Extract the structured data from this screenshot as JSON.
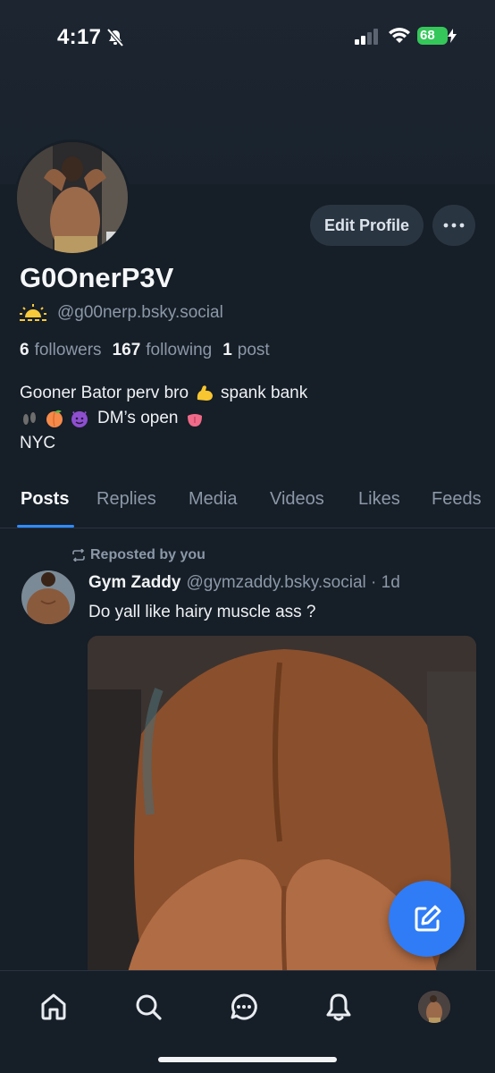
{
  "status_bar": {
    "time": "4:17",
    "battery": "68"
  },
  "profile": {
    "display_name": "G0OnerP3V",
    "handle": "@g00nerp.bsky.social",
    "edit_label": "Edit Profile",
    "followers_count": "6",
    "followers_label": "followers",
    "following_count": "167",
    "following_label": "following",
    "posts_count": "1",
    "posts_label": "post",
    "bio": {
      "line1_a": "Gooner Bator perv bro",
      "line1_b": "spank bank",
      "line2": "DM’s open",
      "line3": "NYC"
    }
  },
  "tabs": [
    "Posts",
    "Replies",
    "Media",
    "Videos",
    "Likes",
    "Feeds"
  ],
  "post": {
    "repost_label": "Reposted by you",
    "author": "Gym Zaddy",
    "handle_time": "@gymzaddy.bsky.social · 1d",
    "text": "Do yall like hairy muscle ass ?"
  },
  "icons": {
    "nav": [
      "home-icon",
      "search-icon",
      "chat-icon",
      "bell-icon",
      "profile-avatar"
    ],
    "accent": "#2f7cf6"
  }
}
